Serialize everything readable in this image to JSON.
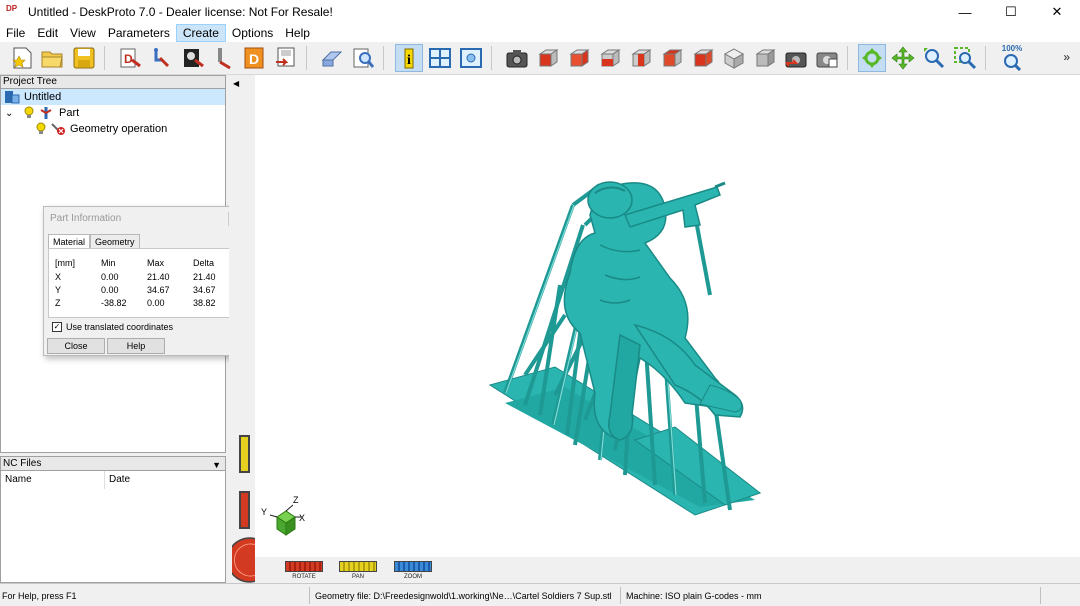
{
  "window": {
    "title": "Untitled - DeskProto 7.0 - Dealer license: Not For Resale!",
    "logo_text": "DP",
    "controls": [
      "—",
      "☐",
      "✕"
    ]
  },
  "menu": [
    "File",
    "Edit",
    "View",
    "Parameters",
    "Create",
    "Options",
    "Help"
  ],
  "menu_active": "Create",
  "toolbar": {
    "zoom_label": "100%",
    "more": "»"
  },
  "project_tree": {
    "header": "Project Tree",
    "items": [
      {
        "label": "Untitled"
      },
      {
        "label": "Part"
      },
      {
        "label": "Geometry operation"
      }
    ]
  },
  "nc_files": {
    "header": "NC Files",
    "columns": [
      "Name",
      "Date"
    ]
  },
  "part_info": {
    "title": "Part Information",
    "tabs": [
      "Material",
      "Geometry"
    ],
    "headers": [
      "[mm]",
      "Min",
      "Max",
      "Delta"
    ],
    "rows": [
      [
        "X",
        "0.00",
        "21.40",
        "21.40"
      ],
      [
        "Y",
        "0.00",
        "34.67",
        "34.67"
      ],
      [
        "Z",
        "-38.82",
        "0.00",
        "38.82"
      ]
    ],
    "checkbox_label": "Use translated coordinates",
    "checkbox_checked": true,
    "close_label": "Close",
    "help_label": "Help"
  },
  "axes": {
    "x": "X",
    "y": "Y",
    "z": "Z"
  },
  "view_controls": [
    "ROTATE",
    "PAN",
    "ZOOM"
  ],
  "status": {
    "help": "For Help, press F1",
    "geometry": "Geometry file: D:\\Freedesignwold\\1.working\\Ne…\\Cartel Soldiers 7 Sup.stl",
    "machine": "Machine: ISO plain G-codes - mm"
  },
  "colors": {
    "model": "#2ab5b0",
    "model_dark": "#1a8a86",
    "selection": "#cce8ff",
    "rotate": "#d23a22",
    "pan": "#e6d020",
    "zoom": "#3a8ad8"
  }
}
